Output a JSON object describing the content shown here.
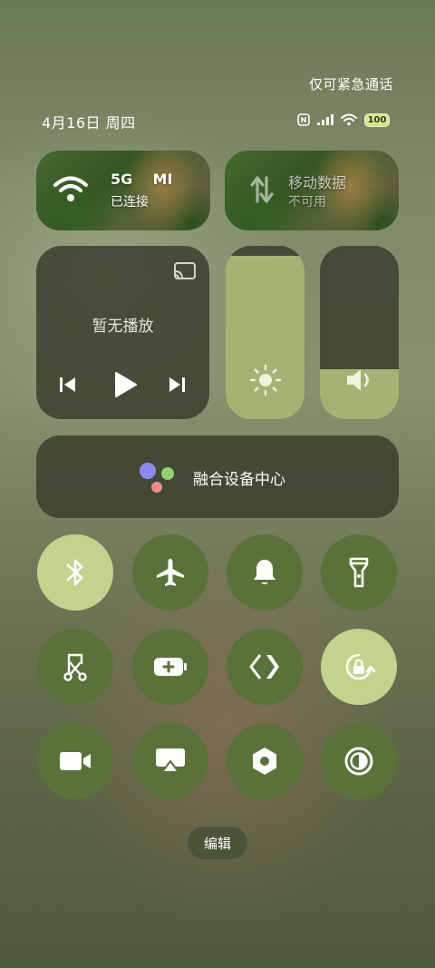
{
  "header": {
    "emergency_text": "仅可紧急通话",
    "date_text": "4月16日 周四",
    "battery_level": "100"
  },
  "network": {
    "wifi": {
      "name": "5G    MI",
      "status": "已连接"
    },
    "mobile": {
      "name": "移动数据",
      "status": "不可用"
    }
  },
  "media": {
    "title": "暂无播放"
  },
  "sliders": {
    "brightness_level": 0.94,
    "volume_level": 0.29
  },
  "fusion": {
    "label": "融合设备中心"
  },
  "toggles": [
    {
      "icon": "bluetooth-icon",
      "on": true
    },
    {
      "icon": "airplane-icon",
      "on": false
    },
    {
      "icon": "bell-icon",
      "on": false
    },
    {
      "icon": "flashlight-icon",
      "on": false
    },
    {
      "icon": "screenshot-scissors-icon",
      "on": false
    },
    {
      "icon": "battery-saver-icon",
      "on": false
    },
    {
      "icon": "code-diamond-icon",
      "on": false
    },
    {
      "icon": "rotation-lock-icon",
      "on": true
    },
    {
      "icon": "video-camera-icon",
      "on": false
    },
    {
      "icon": "screen-cast-icon",
      "on": false
    },
    {
      "icon": "hexagon-nut-icon",
      "on": false
    },
    {
      "icon": "contrast-icon",
      "on": false
    }
  ],
  "edit": {
    "label": "编辑"
  },
  "colors": {
    "accent_on": "#c1d38c",
    "tile_off": "#5a713a",
    "slider_fill": "#a3b374"
  }
}
